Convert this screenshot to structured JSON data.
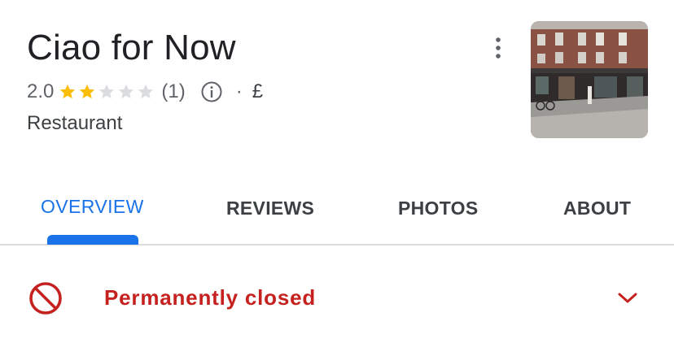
{
  "place": {
    "name": "Ciao for Now",
    "rating": "2.0",
    "rating_value": 2.0,
    "stars_total": 5,
    "review_count": "(1)",
    "separator": "·",
    "price_level": "£",
    "category": "Restaurant"
  },
  "tabs": [
    {
      "label": "OVERVIEW",
      "active": true
    },
    {
      "label": "REVIEWS",
      "active": false
    },
    {
      "label": "PHOTOS",
      "active": false
    },
    {
      "label": "ABOUT",
      "active": false
    }
  ],
  "status": {
    "label": "Permanently closed",
    "color": "#c5221f"
  },
  "colors": {
    "accent": "#1a73e8",
    "star_filled": "#fbbc04",
    "star_empty": "#dadce0",
    "closed": "#c5221f"
  },
  "icons": {
    "info": "info-circle-icon",
    "more": "more-vert-icon",
    "closed": "block-icon",
    "expand": "chevron-down-icon"
  }
}
